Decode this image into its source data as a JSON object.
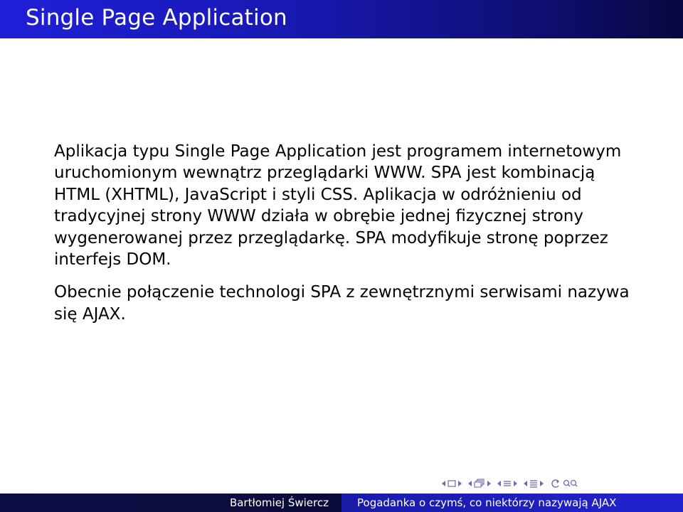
{
  "slide": {
    "title": "Single Page Application",
    "paragraphs": [
      "Aplikacja typu Single Page Application jest programem internetowym uruchomionym wewnątrz przeglądarki WWW. SPA jest kombinacją HTML (XHTML), JavaScript i styli CSS. Aplikacja w odróżnieniu od tradycyjnej strony WWW działa w obrębie jednej fizycznej strony wygenerowanej przez przeglądarkę. SPA modyfikuje stronę poprzez interfejs DOM.",
      "Obecnie połączenie technologi SPA z zewnętrznymi serwisami nazywa się AJAX."
    ]
  },
  "footer": {
    "author": "Bartłomiej Świercz",
    "talk_title": "Pogadanka o czymś, co niektórzy nazywają AJAX"
  },
  "navigation": {
    "icons": [
      "prev-frame-icon",
      "frame-icon",
      "next-frame-icon",
      "prev-subsection-icon",
      "subsection-icon",
      "next-subsection-icon",
      "prev-section-icon",
      "section-icon",
      "next-section-icon",
      "prev-slide-icon",
      "slide-icon",
      "next-slide-icon",
      "back-icon",
      "search-icon"
    ],
    "color": "#6b6bb3"
  },
  "colors": {
    "title_bar": "#1818b0",
    "footer_left": "#0d0d46",
    "footer_right": "#2323d0",
    "text": "#000000"
  }
}
